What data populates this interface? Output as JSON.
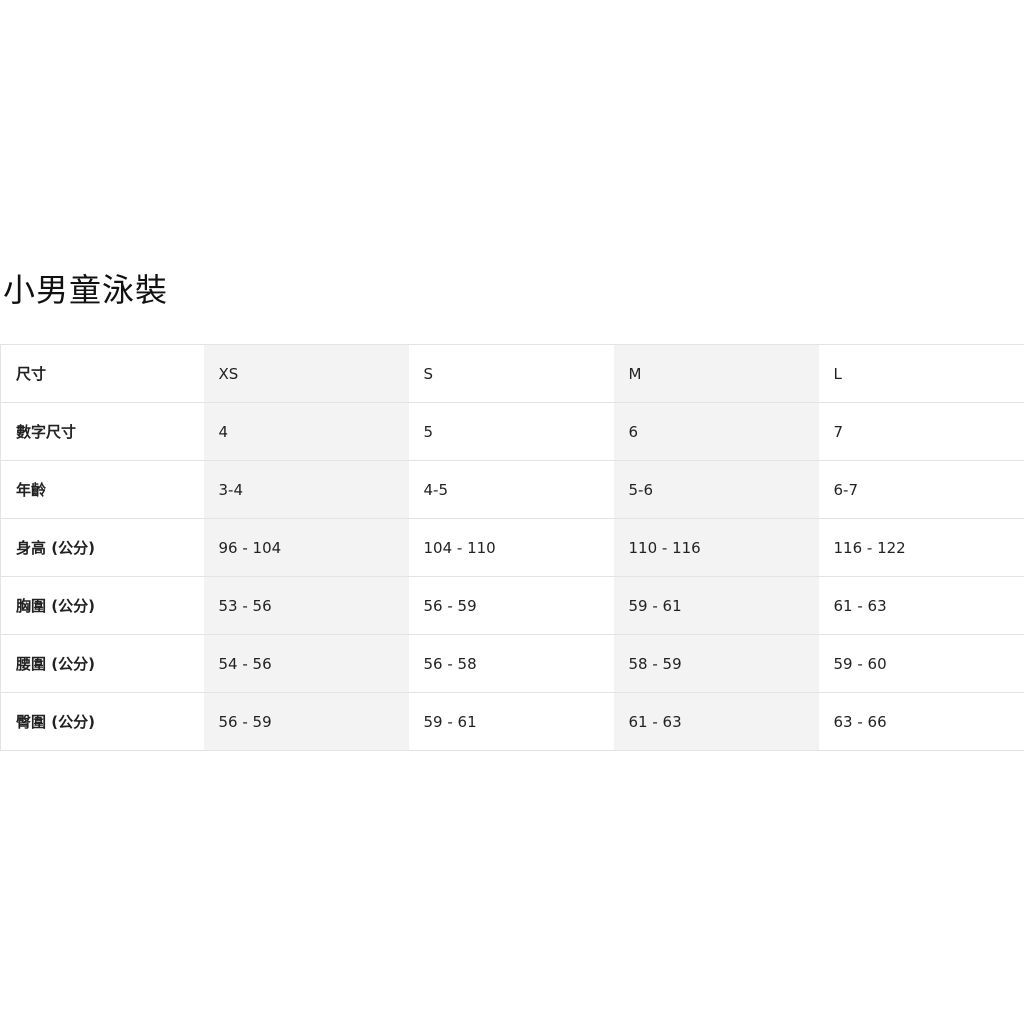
{
  "title": "小男童泳裝",
  "table": {
    "rows": [
      {
        "label": "尺寸",
        "values": [
          "XS",
          "S",
          "M",
          "L"
        ]
      },
      {
        "label": "數字尺寸",
        "values": [
          "4",
          "5",
          "6",
          "7"
        ]
      },
      {
        "label": "年齡",
        "values": [
          "3-4",
          "4-5",
          "5-6",
          "6-7"
        ]
      },
      {
        "label": "身高 (公分)",
        "values": [
          "96 - 104",
          "104 - 110",
          "110 - 116",
          "116 - 122"
        ]
      },
      {
        "label": "胸圍 (公分)",
        "values": [
          "53 - 56",
          "56 - 59",
          "59 - 61",
          "61 - 63"
        ]
      },
      {
        "label": "腰圍 (公分)",
        "values": [
          "54 - 56",
          "56 - 58",
          "58 - 59",
          "59 - 60"
        ]
      },
      {
        "label": "臀圍 (公分)",
        "values": [
          "56 - 59",
          "59 - 61",
          "61 - 63",
          "63 - 66"
        ]
      }
    ]
  },
  "colors": {
    "shaded_column": "#f3f3f3",
    "border": "#e3e3e3",
    "text": "#222222"
  }
}
